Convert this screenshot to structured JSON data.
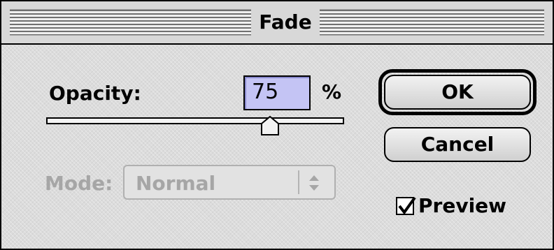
{
  "window": {
    "title": "Fade"
  },
  "opacity": {
    "label": "Opacity:",
    "value": "75",
    "unit": "%",
    "slider_value_percent": 75
  },
  "mode": {
    "label": "Mode:",
    "selected": "Normal",
    "disabled": true
  },
  "buttons": {
    "ok_label": "OK",
    "cancel_label": "Cancel"
  },
  "preview": {
    "label": "Preview",
    "checked": true
  },
  "icons": {
    "slider_thumb": "triangle-thumb-icon",
    "select_arrows": "up-down-arrows-icon",
    "checkbox_check": "checkmark-icon"
  },
  "colors": {
    "field_highlight": "#c4c4f4",
    "disabled_text": "#a6a6a6"
  }
}
